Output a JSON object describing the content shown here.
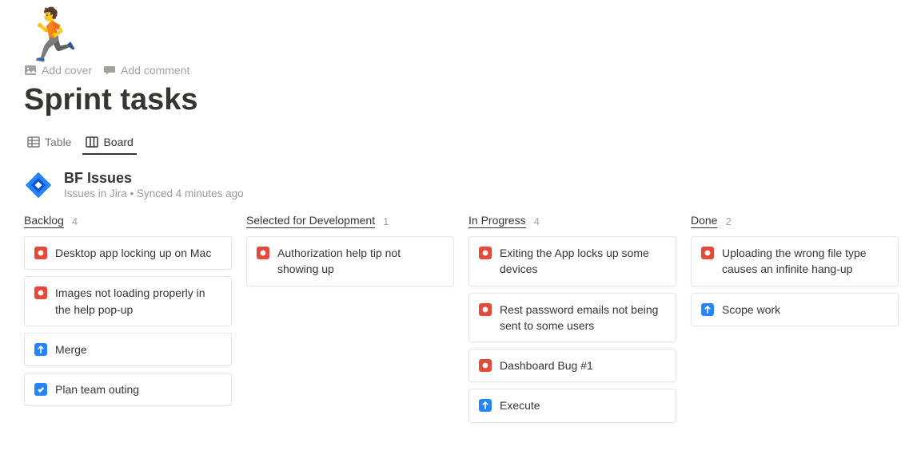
{
  "page_emoji": "🏃",
  "actions": {
    "add_cover": "Add cover",
    "add_comment": "Add comment"
  },
  "title": "Sprint tasks",
  "tabs": [
    {
      "id": "table",
      "label": "Table",
      "active": false
    },
    {
      "id": "board",
      "label": "Board",
      "active": true
    }
  ],
  "database": {
    "title": "BF Issues",
    "subtitle": "Issues in Jira • Synced 4 minutes ago"
  },
  "columns": [
    {
      "name": "Backlog",
      "count": 4,
      "cards": [
        {
          "icon": "red",
          "title": "Desktop app locking up on Mac"
        },
        {
          "icon": "red",
          "title": "Images not loading properly in the help pop-up"
        },
        {
          "icon": "blue",
          "title": "Merge"
        },
        {
          "icon": "blueCheck",
          "title": "Plan team outing"
        }
      ]
    },
    {
      "name": "Selected for Development",
      "count": 1,
      "cards": [
        {
          "icon": "red",
          "title": "Authorization help tip not showing up"
        }
      ]
    },
    {
      "name": "In Progress",
      "count": 4,
      "cards": [
        {
          "icon": "red",
          "title": "Exiting the App locks up some devices"
        },
        {
          "icon": "red",
          "title": "Rest password emails not being sent to some users"
        },
        {
          "icon": "red",
          "title": "Dashboard Bug #1"
        },
        {
          "icon": "blue",
          "title": "Execute"
        }
      ]
    },
    {
      "name": "Done",
      "count": 2,
      "cards": [
        {
          "icon": "red",
          "title": "Uploading the wrong file type causes an infinite hang-up"
        },
        {
          "icon": "blue",
          "title": "Scope work"
        }
      ]
    }
  ]
}
